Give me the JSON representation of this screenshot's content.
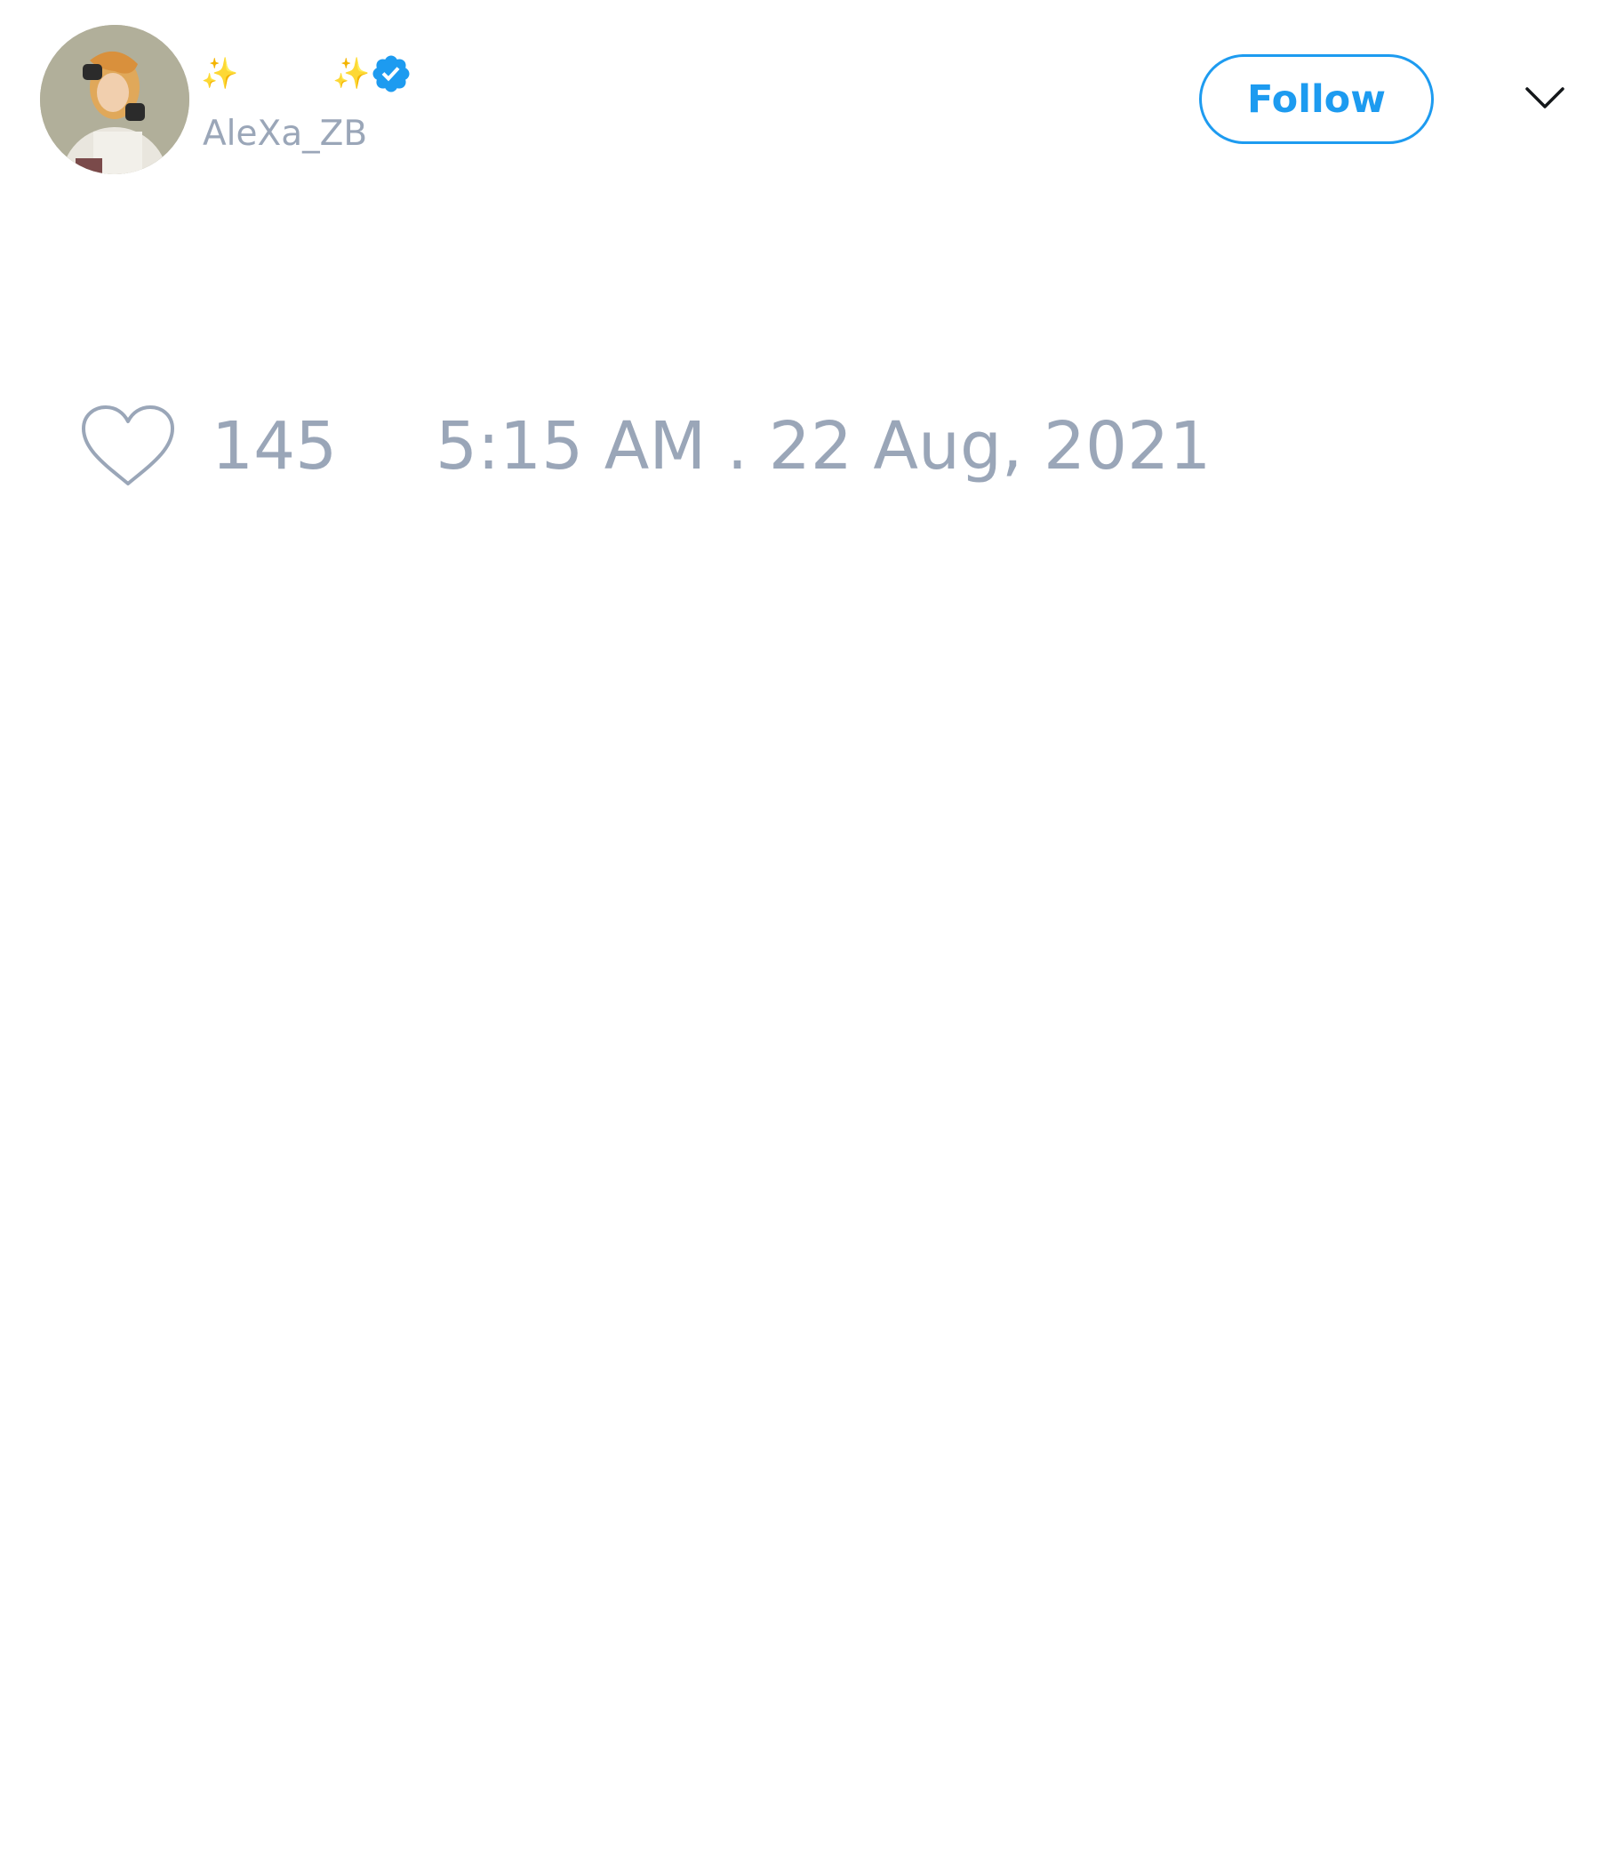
{
  "user": {
    "display_name_prefix": "✨",
    "display_name": "",
    "display_name_suffix": "✨",
    "verified": true,
    "handle": "AleXa_ZB"
  },
  "actions": {
    "follow_label": "Follow"
  },
  "tweet": {
    "like_count": "145",
    "timestamp": "5:15 AM . 22 Aug, 2021"
  },
  "icons": {
    "avatar": "avatar",
    "verified": "verified-badge-icon",
    "menu": "chevron-down-icon",
    "like": "heart-icon"
  },
  "colors": {
    "accent": "#1d9bf0",
    "muted_text": "#9aa6b8",
    "sparkle": "#f5c518"
  }
}
